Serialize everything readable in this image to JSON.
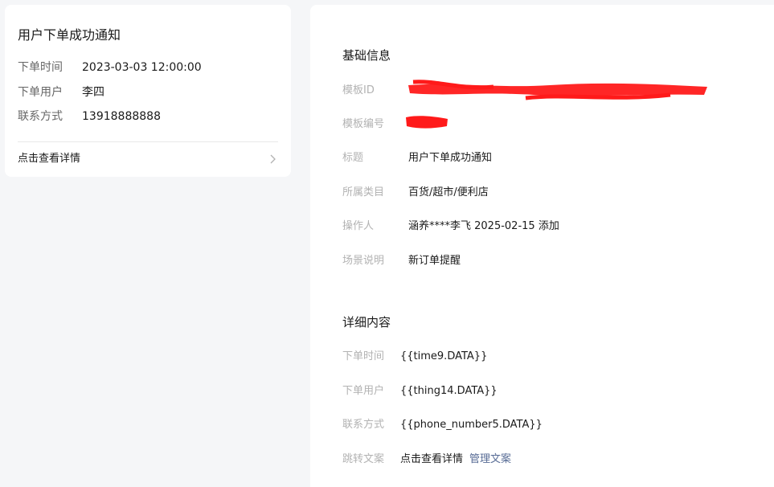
{
  "preview": {
    "title": "用户下单成功通知",
    "rows": [
      {
        "label": "下单时间",
        "value": "2023-03-03 12:00:00"
      },
      {
        "label": "下单用户",
        "value": "李四"
      },
      {
        "label": "联系方式",
        "value": "13918888888"
      }
    ],
    "link_label": "点击查看详情"
  },
  "basic_info": {
    "title": "基础信息",
    "template_id_label": "模板ID",
    "template_number_label": "模板编号",
    "title_label": "标题",
    "title_value": "用户下单成功通知",
    "category_label": "所属类目",
    "category_value": "百货/超市/便利店",
    "operator_label": "操作人",
    "operator_value": "涵养****李飞 2025-02-15 添加",
    "scene_label": "场景说明",
    "scene_value": "新订单提醒"
  },
  "detail": {
    "title": "详细内容",
    "rows": [
      {
        "label": "下单时间",
        "value": "{{time9.DATA}}"
      },
      {
        "label": "下单用户",
        "value": "{{thing14.DATA}}"
      },
      {
        "label": "联系方式",
        "value": "{{phone_number5.DATA}}"
      }
    ],
    "jump_label": "跳转文案",
    "jump_value": "点击查看详情",
    "manage_link": "管理文案"
  },
  "colors": {
    "background": "#f5f6f8",
    "card": "#ffffff",
    "label_gray": "#b2b2b2",
    "link_blue": "#576b95",
    "redaction_red": "#ff0000"
  }
}
